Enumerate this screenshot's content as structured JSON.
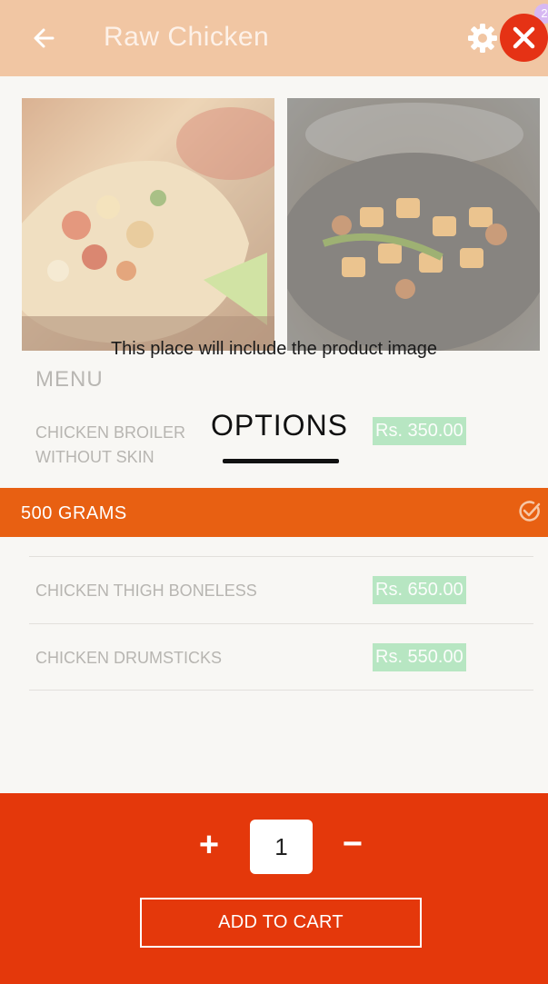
{
  "header": {
    "title": "Raw Chicken",
    "badge": "2"
  },
  "media": {
    "caption": "This place will include the product image",
    "images": [
      "chicken-wrap",
      "chicken-stir-fry"
    ]
  },
  "menu": {
    "label": "MENU",
    "items": [
      {
        "name_line1": "CHICKEN BROILER",
        "name_line2": "WITHOUT SKIN",
        "price": "Rs. 350.00"
      },
      {
        "name": "CHICKEN THIGH BONELESS",
        "price": "Rs. 650.00"
      },
      {
        "name": "CHICKEN DRUMSTICKS",
        "price": "Rs. 550.00"
      }
    ]
  },
  "options": {
    "title": "OPTIONS",
    "selected": "500 GRAMS"
  },
  "cart": {
    "plus": "+",
    "quantity": "1",
    "minus": "−",
    "add_label": "ADD TO CART"
  },
  "colors": {
    "header_bg": "#f1c6a3",
    "close_bg": "#e53215",
    "option_bg": "#e86012",
    "price_bg": "#b7e6c2",
    "bottom_bg": "#e4380b"
  }
}
